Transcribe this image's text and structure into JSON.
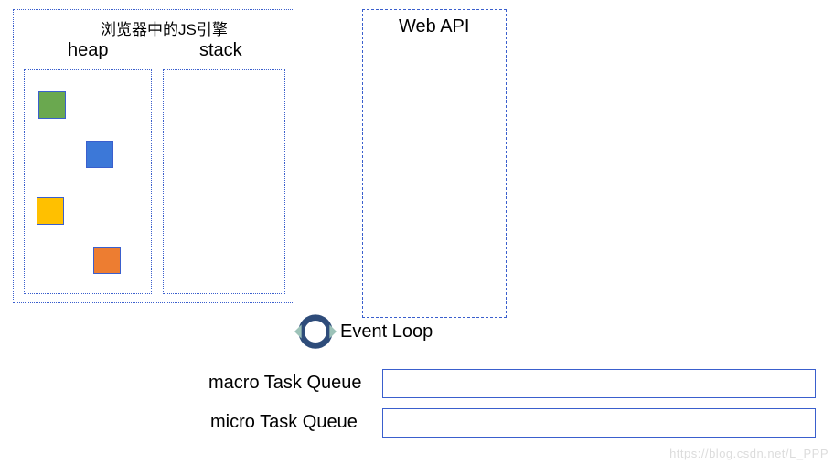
{
  "engine": {
    "title": "浏览器中的JS引擎",
    "heap_label": "heap",
    "stack_label": "stack",
    "heap_objects": [
      {
        "color": "#6aa84f"
      },
      {
        "color": "#3c78d8"
      },
      {
        "color": "#ffc000"
      },
      {
        "color": "#ed7d31"
      }
    ]
  },
  "webapi": {
    "label": "Web API"
  },
  "event_loop": {
    "label": "Event Loop"
  },
  "queues": {
    "macro_label": "macro Task Queue",
    "micro_label": "micro Task Queue"
  },
  "watermark": "https://blog.csdn.net/L_PPP"
}
